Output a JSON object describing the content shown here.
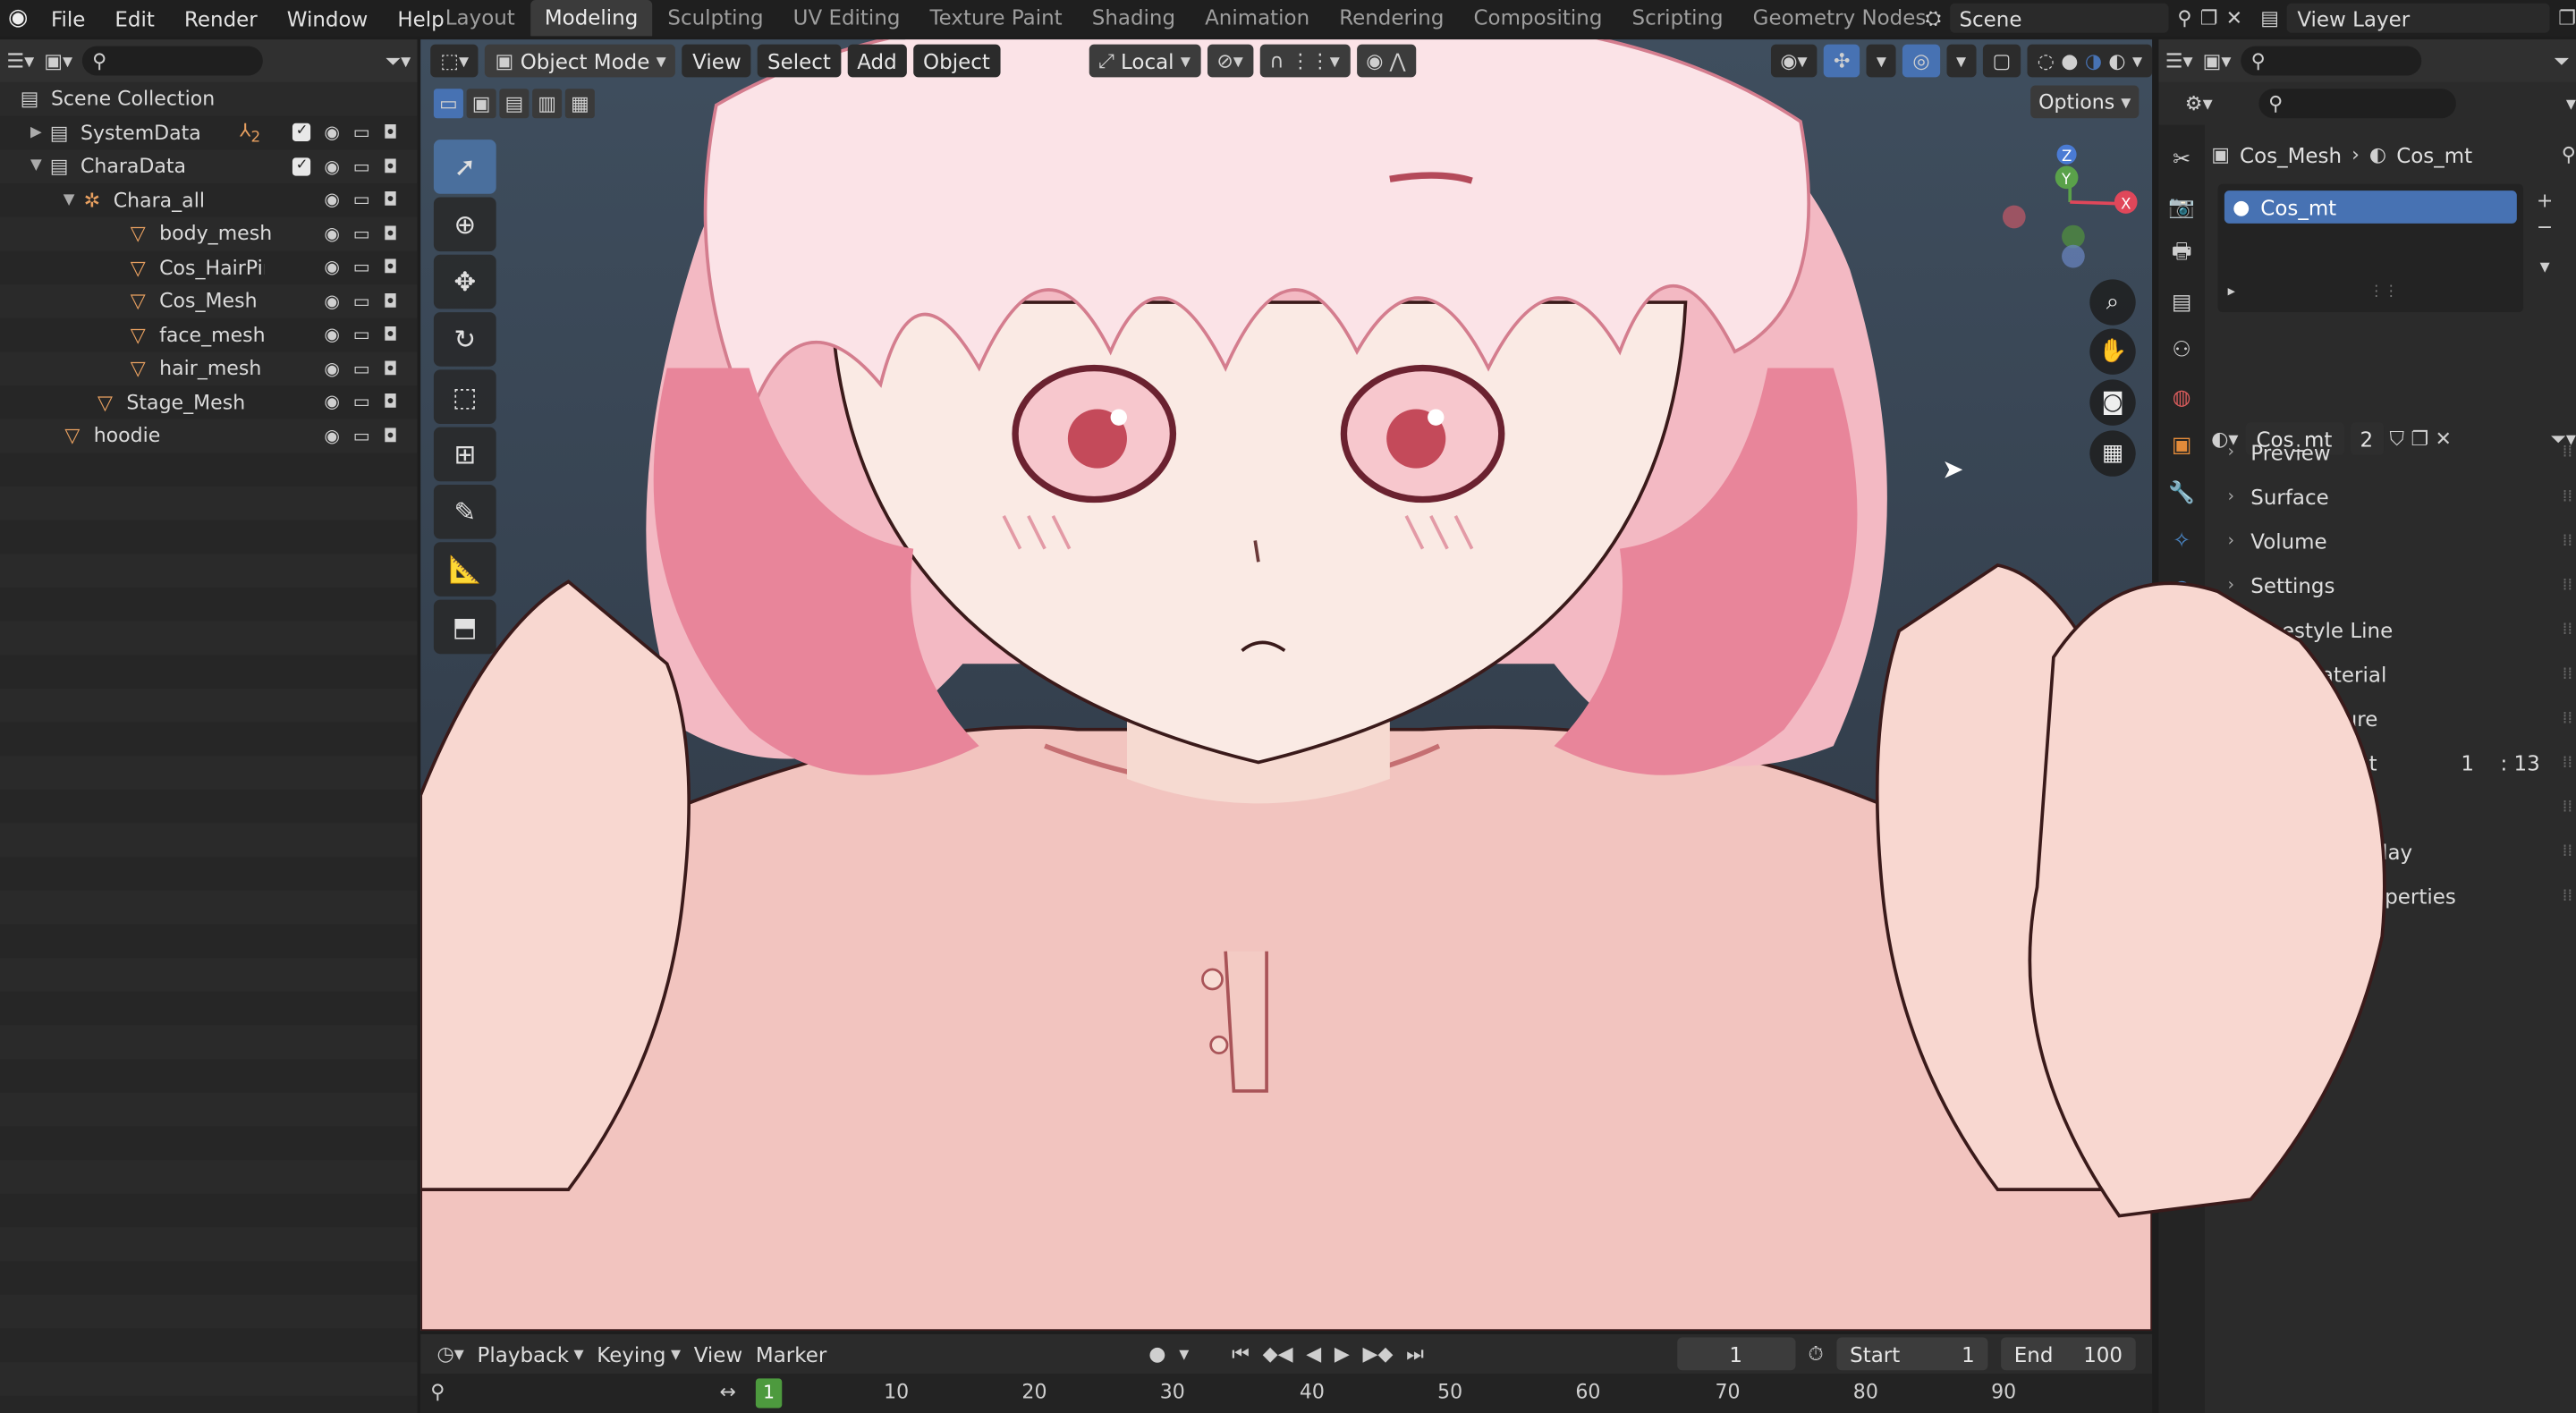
{
  "topbar": {
    "menus": [
      "File",
      "Edit",
      "Render",
      "Window",
      "Help"
    ],
    "workspaces": [
      "Layout",
      "Modeling",
      "Sculpting",
      "UV Editing",
      "Texture Paint",
      "Shading",
      "Animation",
      "Rendering",
      "Compositing",
      "Scripting",
      "Geometry Nodes"
    ],
    "active_workspace": "Modeling",
    "add_tab": "+",
    "scene": "Scene",
    "view_layer": "View Layer"
  },
  "outliner": {
    "root": "Scene Collection",
    "items": [
      {
        "label": "SystemData",
        "type": "collection",
        "badge": "2"
      },
      {
        "label": "CharaData",
        "type": "collection"
      },
      {
        "label": "Chara_all",
        "type": "armature"
      },
      {
        "label": "body_mesh",
        "type": "mesh"
      },
      {
        "label": "Cos_HairPin",
        "type": "mesh"
      },
      {
        "label": "Cos_Mesh",
        "type": "mesh"
      },
      {
        "label": "face_mesh",
        "type": "mesh"
      },
      {
        "label": "hair_mesh",
        "type": "mesh"
      },
      {
        "label": "Stage_Mesh",
        "type": "mesh"
      },
      {
        "label": "hoodie",
        "type": "mesh"
      }
    ]
  },
  "viewport": {
    "mode": "Object Mode",
    "menus": [
      "View",
      "Select",
      "Add",
      "Object"
    ],
    "transform_orientation": "Local",
    "options": "Options",
    "gizmo": {
      "z": "Z",
      "y": "Y",
      "x": "X"
    }
  },
  "properties": {
    "breadcrumb_object": "Cos_Mesh",
    "breadcrumb_material": "Cos_mt",
    "slot": "Cos_mt",
    "material_name": "Cos_mt",
    "material_users": "2",
    "panels": [
      "Preview",
      "Surface",
      "Volume",
      "Settings",
      "Freestyle Line",
      "Material",
      "D Texture",
      "al List",
      "",
      "play",
      "om Properties"
    ],
    "pass_list_values": [
      "1",
      ": 13"
    ]
  },
  "timeline": {
    "menus": [
      "Playback",
      "Keying",
      "View",
      "Marker"
    ],
    "current_frame": "1",
    "start_label": "Start",
    "start": "1",
    "end_label": "End",
    "end": "100",
    "ruler": [
      "10",
      "20",
      "30",
      "40",
      "50",
      "60",
      "70",
      "80",
      "90"
    ],
    "playhead": "1"
  },
  "colors": {
    "accent_blue": "#4772b3",
    "mesh_orange": "#e8a060",
    "hair_pink": "#e8859a",
    "skin": "#f7d8cf"
  }
}
